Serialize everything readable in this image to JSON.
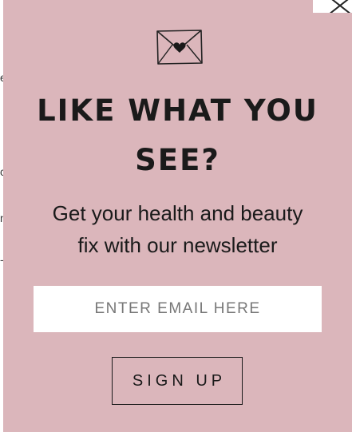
{
  "modal": {
    "headline_line1": "LIKE WHAT YOU",
    "headline_line2": "SEE?",
    "subtitle_line1": "Get your health and beauty",
    "subtitle_line2": "fix with our newsletter",
    "email_placeholder": "ENTER EMAIL HERE",
    "signup_label": "SIGN UP",
    "background_color": "#dbb6bb",
    "icons": {
      "envelope": "envelope-heart-icon",
      "close": "close-icon"
    }
  }
}
